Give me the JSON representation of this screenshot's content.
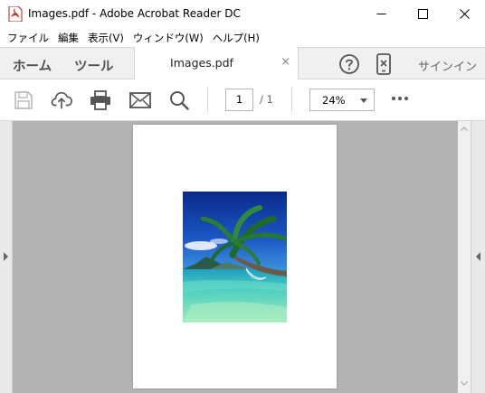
{
  "window": {
    "title": "Images.pdf - Adobe Acrobat Reader DC",
    "app_icon": "acrobat-pdf-icon",
    "controls": [
      "minimize-icon",
      "maximize-icon",
      "close-icon"
    ]
  },
  "menu": {
    "items": [
      {
        "label": "ファイル"
      },
      {
        "label": "編集"
      },
      {
        "label": "表示(V)"
      },
      {
        "label": "ウィンドウ(W)"
      },
      {
        "label": "ヘルプ(H)"
      }
    ]
  },
  "tabs": {
    "home": "ホーム",
    "tools": "ツール",
    "document": "Images.pdf",
    "close_glyph": "×",
    "signin": "サインイン",
    "icons": [
      "help-icon",
      "mobile-link-icon"
    ]
  },
  "toolbar": {
    "icons": [
      "save-icon",
      "upload-cloud-icon",
      "print-icon",
      "email-icon",
      "search-icon",
      "more-icon"
    ],
    "page_current": "1",
    "page_total": "/ 1",
    "zoom": "24%"
  },
  "document": {
    "image_description_icon": "palm-beach-photo",
    "colors": {
      "sky_top": "#0b2a8a",
      "sky_mid": "#2a74d0",
      "sea": "#4fd0c0",
      "palm": "#1f6a2a",
      "canvas": "#b3b3b3"
    }
  }
}
